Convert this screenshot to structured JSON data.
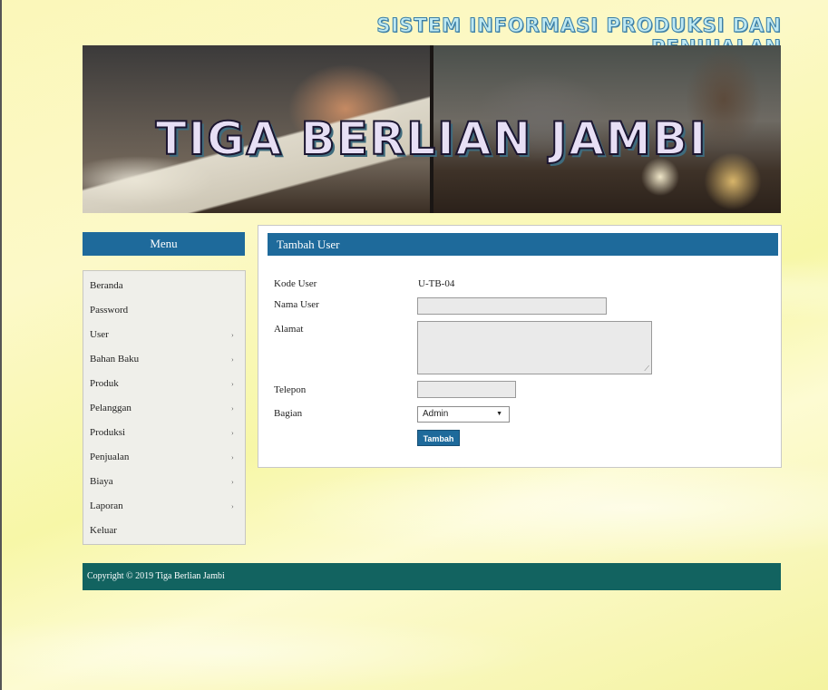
{
  "header": {
    "site_title": "SISTEM INFORMASI PRODUKSI DAN PENJUALAN",
    "banner_text": "TIGA BERLIAN JAMBI"
  },
  "sidebar": {
    "title": "Menu",
    "items": [
      {
        "label": "Beranda",
        "has_submenu": false
      },
      {
        "label": "Password",
        "has_submenu": false
      },
      {
        "label": "User",
        "has_submenu": true
      },
      {
        "label": "Bahan Baku",
        "has_submenu": true
      },
      {
        "label": "Produk",
        "has_submenu": true
      },
      {
        "label": "Pelanggan",
        "has_submenu": true
      },
      {
        "label": "Produksi",
        "has_submenu": true
      },
      {
        "label": "Penjualan",
        "has_submenu": true
      },
      {
        "label": "Biaya",
        "has_submenu": true
      },
      {
        "label": "Laporan",
        "has_submenu": true
      },
      {
        "label": "Keluar",
        "has_submenu": false
      }
    ],
    "submenu_arrow": "›"
  },
  "form": {
    "title": "Tambah User",
    "kode_user_label": "Kode User",
    "kode_user_value": "U-TB-04",
    "nama_user_label": "Nama User",
    "nama_user_value": "",
    "alamat_label": "Alamat",
    "alamat_value": "",
    "telepon_label": "Telepon",
    "telepon_value": "",
    "bagian_label": "Bagian",
    "bagian_selected": "Admin",
    "submit_label": "Tambah"
  },
  "footer": {
    "copyright": "Copyright © 2019 Tiga Berlian Jambi"
  },
  "colors": {
    "primary_blue": "#1e6a9b",
    "footer_teal": "#126360",
    "background": "#fbf7b9"
  },
  "icons": {
    "submenu": "chevron-right-icon",
    "select": "caret-down-icon",
    "textarea": "resize-grip-icon"
  }
}
